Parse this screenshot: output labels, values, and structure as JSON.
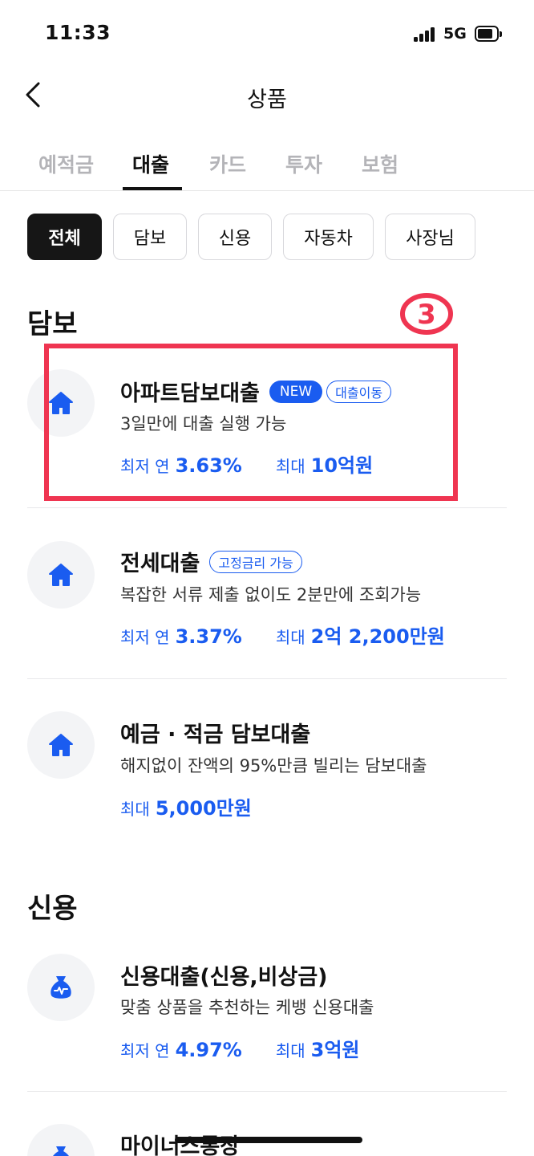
{
  "status_bar": {
    "time": "11:33",
    "network": "5G"
  },
  "header": {
    "back_icon": "chevron-left-icon",
    "title": "상품"
  },
  "tabs": [
    {
      "label": "예적금",
      "active": false
    },
    {
      "label": "대출",
      "active": true
    },
    {
      "label": "카드",
      "active": false
    },
    {
      "label": "투자",
      "active": false
    },
    {
      "label": "보험",
      "active": false
    }
  ],
  "chips": [
    {
      "label": "전체",
      "active": true
    },
    {
      "label": "담보",
      "active": false
    },
    {
      "label": "신용",
      "active": false
    },
    {
      "label": "자동차",
      "active": false
    },
    {
      "label": "사장님",
      "active": false
    }
  ],
  "annotation": {
    "number": "3",
    "color": "#ef3551"
  },
  "sections": {
    "secured": {
      "title": "담보",
      "items": [
        {
          "icon": "house-icon",
          "title": "아파트담보대출",
          "badge_new": "NEW",
          "badge_tag": "대출이동",
          "desc": "3일만에 대출 실행 가능",
          "rate_label": "최저 연",
          "rate_value": "3.63%",
          "max_label": "최대",
          "max_value": "10억원"
        },
        {
          "icon": "house-icon",
          "title": "전세대출",
          "badge_tag": "고정금리 가능",
          "desc": "복잡한 서류 제출 없이도 2분만에 조회가능",
          "rate_label": "최저 연",
          "rate_value": "3.37%",
          "max_label": "최대",
          "max_value": "2억 2,200만원"
        },
        {
          "icon": "house-icon",
          "title": "예금 · 적금 담보대출",
          "desc": "해지없이 잔액의 95%만큼 빌리는 담보대출",
          "max_label": "최대",
          "max_value": "5,000만원"
        }
      ]
    },
    "credit": {
      "title": "신용",
      "items": [
        {
          "icon": "money-bag-icon",
          "title": "신용대출(신용,비상금)",
          "desc": "맞춤 상품을 추천하는 케뱅 신용대출",
          "rate_label": "최저 연",
          "rate_value": "4.97%",
          "max_label": "최대",
          "max_value": "3억원"
        },
        {
          "icon": "money-bag-icon",
          "title": "마이너스통장"
        }
      ]
    }
  },
  "colors": {
    "accent": "#1a5cf0",
    "chip_active": "#161616",
    "tab_inactive": "#b4b4b8"
  }
}
